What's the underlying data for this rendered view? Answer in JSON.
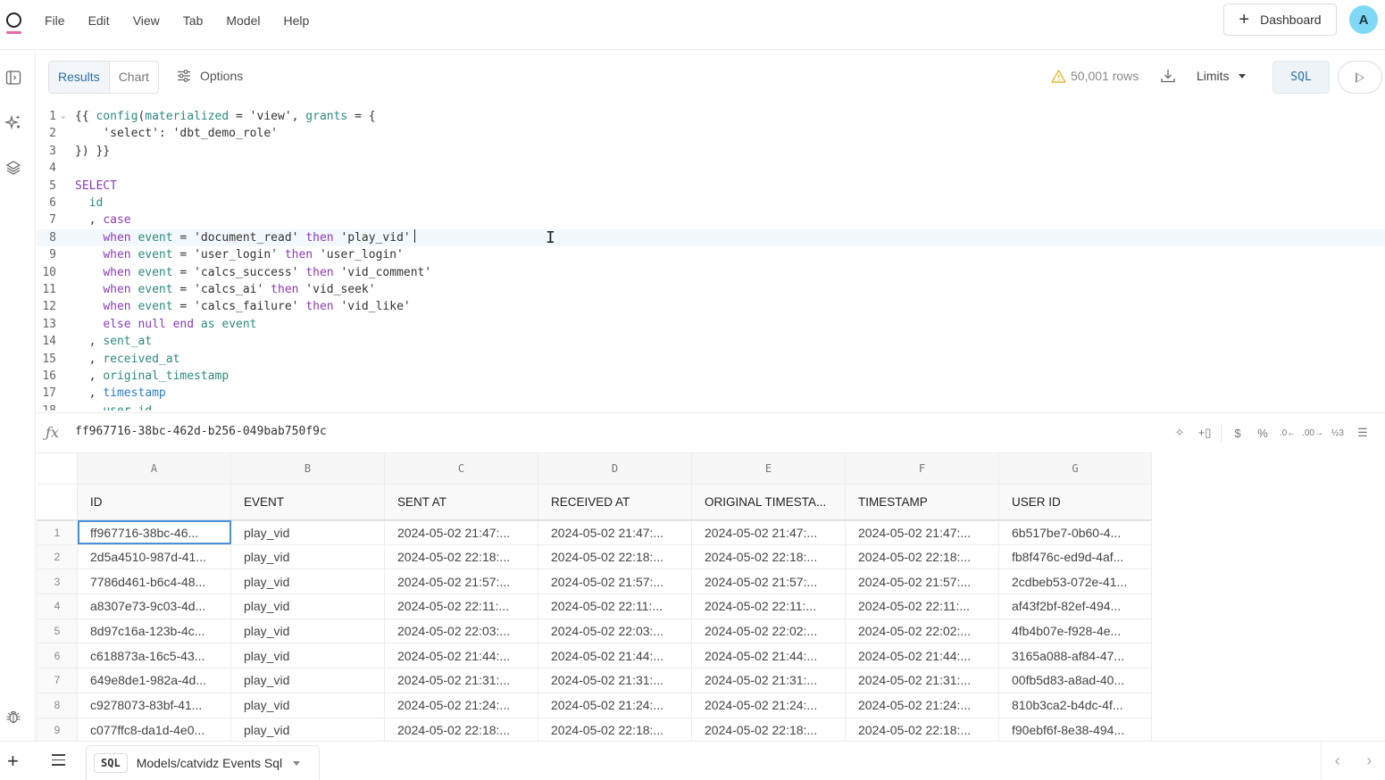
{
  "app": {
    "menu": [
      "File",
      "Edit",
      "View",
      "Tab",
      "Model",
      "Help"
    ],
    "dashboard_button": "Dashboard",
    "avatar_initial": "A",
    "accent": "#e36aa4"
  },
  "toolbar": {
    "tabs": [
      {
        "label": "Results",
        "active": true
      },
      {
        "label": "Chart",
        "active": false
      }
    ],
    "options_label": "Options",
    "row_count": "50,001 rows",
    "limits_label": "Limits",
    "sql_label": "SQL"
  },
  "editor": {
    "current_line": 8,
    "lines": [
      {
        "n": "1",
        "fold": true,
        "tokens": [
          [
            "p",
            "{{ "
          ],
          [
            "fn",
            "config"
          ],
          [
            "p",
            "("
          ],
          [
            "id",
            "materialized"
          ],
          [
            "p",
            " = 'view', "
          ],
          [
            "id",
            "grants"
          ],
          [
            "p",
            " = {"
          ]
        ]
      },
      {
        "n": "2",
        "tokens": [
          [
            "p",
            "    'select': 'dbt_demo_role'"
          ]
        ]
      },
      {
        "n": "3",
        "tokens": [
          [
            "p",
            "}) }}"
          ]
        ]
      },
      {
        "n": "4",
        "tokens": []
      },
      {
        "n": "5",
        "tokens": [
          [
            "kw",
            "SELECT"
          ]
        ]
      },
      {
        "n": "6",
        "tokens": [
          [
            "p",
            "  "
          ],
          [
            "id",
            "id"
          ]
        ]
      },
      {
        "n": "7",
        "tokens": [
          [
            "p",
            "  , "
          ],
          [
            "kw",
            "case"
          ]
        ]
      },
      {
        "n": "8",
        "tokens": [
          [
            "p",
            "    "
          ],
          [
            "kw",
            "when"
          ],
          [
            "p",
            " "
          ],
          [
            "id",
            "event"
          ],
          [
            "p",
            " = 'document_read' "
          ],
          [
            "kw",
            "then"
          ],
          [
            "p",
            " 'play_vid'"
          ]
        ]
      },
      {
        "n": "9",
        "tokens": [
          [
            "p",
            "    "
          ],
          [
            "kw",
            "when"
          ],
          [
            "p",
            " "
          ],
          [
            "id",
            "event"
          ],
          [
            "p",
            " = 'user_login' "
          ],
          [
            "kw",
            "then"
          ],
          [
            "p",
            " 'user_login'"
          ]
        ]
      },
      {
        "n": "10",
        "tokens": [
          [
            "p",
            "    "
          ],
          [
            "kw",
            "when"
          ],
          [
            "p",
            " "
          ],
          [
            "id",
            "event"
          ],
          [
            "p",
            " = 'calcs_success' "
          ],
          [
            "kw",
            "then"
          ],
          [
            "p",
            " 'vid_comment'"
          ]
        ]
      },
      {
        "n": "11",
        "tokens": [
          [
            "p",
            "    "
          ],
          [
            "kw",
            "when"
          ],
          [
            "p",
            " "
          ],
          [
            "id",
            "event"
          ],
          [
            "p",
            " = 'calcs_ai' "
          ],
          [
            "kw",
            "then"
          ],
          [
            "p",
            " 'vid_seek'"
          ]
        ]
      },
      {
        "n": "12",
        "tokens": [
          [
            "p",
            "    "
          ],
          [
            "kw",
            "when"
          ],
          [
            "p",
            " "
          ],
          [
            "id",
            "event"
          ],
          [
            "p",
            " = 'calcs_failure' "
          ],
          [
            "kw",
            "then"
          ],
          [
            "p",
            " 'vid_like'"
          ]
        ]
      },
      {
        "n": "13",
        "tokens": [
          [
            "p",
            "    "
          ],
          [
            "kw",
            "else null end"
          ],
          [
            "p",
            " "
          ],
          [
            "id",
            "as"
          ],
          [
            "p",
            " "
          ],
          [
            "id",
            "event"
          ]
        ]
      },
      {
        "n": "14",
        "tokens": [
          [
            "p",
            "  , "
          ],
          [
            "id",
            "sent_at"
          ]
        ]
      },
      {
        "n": "15",
        "tokens": [
          [
            "p",
            "  , "
          ],
          [
            "id",
            "received_at"
          ]
        ]
      },
      {
        "n": "16",
        "tokens": [
          [
            "p",
            "  , "
          ],
          [
            "id",
            "original_timestamp"
          ]
        ]
      },
      {
        "n": "17",
        "tokens": [
          [
            "p",
            "  , "
          ],
          [
            "blue",
            "timestamp"
          ]
        ]
      },
      {
        "n": "18",
        "tokens": [
          [
            "p",
            "  , "
          ],
          [
            "id",
            "user_id"
          ]
        ]
      }
    ]
  },
  "formula_bar": {
    "value": "ff967716-38bc-462d-b256-049bab750f9c"
  },
  "grid": {
    "column_letters": [
      "A",
      "B",
      "C",
      "D",
      "E",
      "F",
      "G"
    ],
    "columns": [
      "ID",
      "EVENT",
      "SENT AT",
      "RECEIVED AT",
      "ORIGINAL TIMESTA...",
      "TIMESTAMP",
      "USER ID"
    ],
    "rows": [
      [
        "ff967716-38bc-46...",
        "play_vid",
        "2024-05-02 21:47:...",
        "2024-05-02 21:47:...",
        "2024-05-02 21:47:...",
        "2024-05-02 21:47:...",
        "6b517be7-0b60-4..."
      ],
      [
        "2d5a4510-987d-41...",
        "play_vid",
        "2024-05-02 22:18:...",
        "2024-05-02 22:18:...",
        "2024-05-02 22:18:...",
        "2024-05-02 22:18:...",
        "fb8f476c-ed9d-4af..."
      ],
      [
        "7786d461-b6c4-48...",
        "play_vid",
        "2024-05-02 21:57:...",
        "2024-05-02 21:57:...",
        "2024-05-02 21:57:...",
        "2024-05-02 21:57:...",
        "2cdbeb53-072e-41..."
      ],
      [
        "a8307e73-9c03-4d...",
        "play_vid",
        "2024-05-02 22:11:...",
        "2024-05-02 22:11:...",
        "2024-05-02 22:11:...",
        "2024-05-02 22:11:...",
        "af43f2bf-82ef-494..."
      ],
      [
        "8d97c16a-123b-4c...",
        "play_vid",
        "2024-05-02 22:03:...",
        "2024-05-02 22:03:...",
        "2024-05-02 22:02:...",
        "2024-05-02 22:02:...",
        "4fb4b07e-f928-4e..."
      ],
      [
        "c618873a-16c5-43...",
        "play_vid",
        "2024-05-02 21:44:...",
        "2024-05-02 21:44:...",
        "2024-05-02 21:44:...",
        "2024-05-02 21:44:...",
        "3165a088-af84-47..."
      ],
      [
        "649e8de1-982a-4d...",
        "play_vid",
        "2024-05-02 21:31:...",
        "2024-05-02 21:31:...",
        "2024-05-02 21:31:...",
        "2024-05-02 21:31:...",
        "00fb5d83-a8ad-40..."
      ],
      [
        "c9278073-83bf-41...",
        "play_vid",
        "2024-05-02 21:24:...",
        "2024-05-02 21:24:...",
        "2024-05-02 21:24:...",
        "2024-05-02 21:24:...",
        "810b3ca2-b4dc-4f..."
      ],
      [
        "c077ffc8-da1d-4e0...",
        "play_vid",
        "2024-05-02 22:18:...",
        "2024-05-02 22:18:...",
        "2024-05-02 22:18:...",
        "2024-05-02 22:18:...",
        "f90ebf6f-8e38-494..."
      ]
    ]
  },
  "bottom": {
    "tab_badge": "SQL",
    "tab_title": "Models/catvidz Events Sql"
  }
}
